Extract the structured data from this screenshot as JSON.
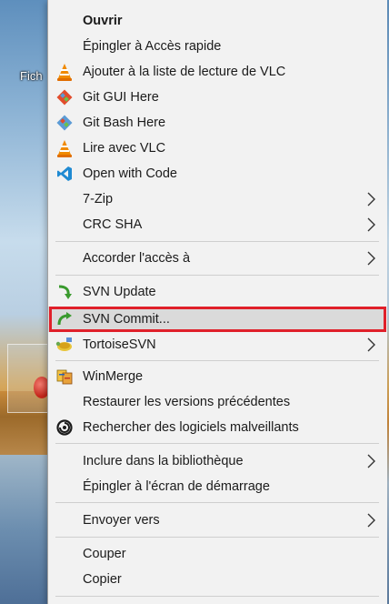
{
  "desktop": {
    "icon_label": "Fich"
  },
  "menu": {
    "items": [
      {
        "label": "Ouvrir",
        "icon": "",
        "arrow": false
      },
      {
        "label": "Épingler à Accès rapide",
        "icon": "",
        "arrow": false
      },
      {
        "label": "Ajouter à la liste de lecture de VLC",
        "icon": "vlc-icon",
        "arrow": false
      },
      {
        "label": "Git GUI Here",
        "icon": "git-gui-icon",
        "arrow": false
      },
      {
        "label": "Git Bash Here",
        "icon": "git-bash-icon",
        "arrow": false
      },
      {
        "label": "Lire avec VLC",
        "icon": "vlc-icon",
        "arrow": false
      },
      {
        "label": "Open with Code",
        "icon": "vscode-icon",
        "arrow": false
      },
      {
        "label": "7-Zip",
        "icon": "",
        "arrow": true
      },
      {
        "label": "CRC SHA",
        "icon": "",
        "arrow": true
      },
      {
        "label": "Accorder l'accès à",
        "icon": "",
        "arrow": true
      },
      {
        "label": "SVN Update",
        "icon": "svn-update-icon",
        "arrow": false
      },
      {
        "label": "SVN Commit...",
        "icon": "svn-commit-icon",
        "arrow": false
      },
      {
        "label": "TortoiseSVN",
        "icon": "tortoisesvn-icon",
        "arrow": true
      },
      {
        "label": "WinMerge",
        "icon": "winmerge-icon",
        "arrow": false
      },
      {
        "label": "Restaurer les versions précédentes",
        "icon": "",
        "arrow": false
      },
      {
        "label": "Rechercher des logiciels malveillants",
        "icon": "defender-icon",
        "arrow": false
      },
      {
        "label": "Inclure dans la bibliothèque",
        "icon": "",
        "arrow": true
      },
      {
        "label": "Épingler à l'écran de démarrage",
        "icon": "",
        "arrow": false
      },
      {
        "label": "Envoyer vers",
        "icon": "",
        "arrow": true
      },
      {
        "label": "Couper",
        "icon": "",
        "arrow": false
      },
      {
        "label": "Copier",
        "icon": "",
        "arrow": false
      }
    ],
    "highlighted_item": "SVN Commit...",
    "highlight_color": "#e0202a"
  }
}
